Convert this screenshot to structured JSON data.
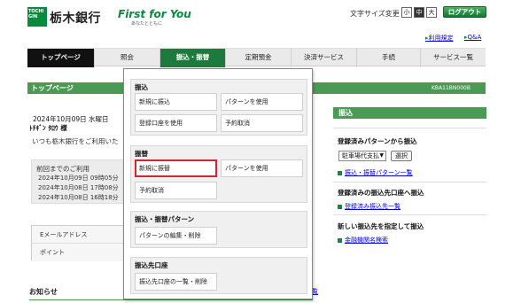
{
  "header": {
    "logo_text": "TOCHI GIN",
    "bank_name": "栃木銀行",
    "brand": "First for You",
    "brand_sub": "あなたとともに",
    "font_size_label": "文字サイズ変更",
    "font_sizes": [
      "小",
      "中",
      "大"
    ],
    "logout": "ログアウト",
    "links": [
      "利用規定",
      "Q&A"
    ]
  },
  "nav": {
    "items": [
      "トップページ",
      "照会",
      "振込・振替",
      "定期預金",
      "決済サービス",
      "手続",
      "サービス一覧"
    ]
  },
  "page": {
    "title": "トップページ",
    "code": "KBA11BN000B",
    "date": "2024年10月09日 水曜日",
    "name": "ﾄﾁｷﾞﾝ ﾀﾛｳ 様",
    "welcome": "いつも栃木銀行をご利用いた",
    "login_title": "前回までのご利用",
    "login_rows": [
      "2024年10月09日 09時05分",
      "2024年10月08日 17時08分",
      "2024年10月08日 16時18分"
    ],
    "info_rows": [
      "Eメールアドレス",
      "ポイント"
    ],
    "news": "お知らせ",
    "news_link": "覧"
  },
  "sidebar": {
    "title": "振込",
    "pattern_head": "登録済みパターンから振込",
    "select_value": "駐車場代支払",
    "select_button": "選択",
    "pattern_link": "振込・振替パターン一覧",
    "registered_head": "登録済みの振込先口座へ振込",
    "registered_link": "登録済み振込先一覧",
    "new_head": "新しい振込先を指定して振込",
    "new_link": "金融機関名検索"
  },
  "menu": {
    "sections": [
      {
        "title": "振込",
        "options": [
          "新規に振込",
          "パターンを使用",
          "登録口座を使用",
          "予約取消"
        ]
      },
      {
        "title": "振替",
        "options": [
          "新規に振替",
          "パターンを使用",
          "予約取消"
        ]
      },
      {
        "title": "振込・振替パターン",
        "options": [
          "パターンの編集・削除"
        ]
      },
      {
        "title": "振込先口座",
        "options": [
          "振込先口座の一覧・削除"
        ]
      }
    ]
  },
  "colors": {
    "brand_green": "#0a8a3c",
    "bar_green": "#4a9a55",
    "nav_active": "#1c7a3c",
    "highlight_red": "#d9232e"
  }
}
